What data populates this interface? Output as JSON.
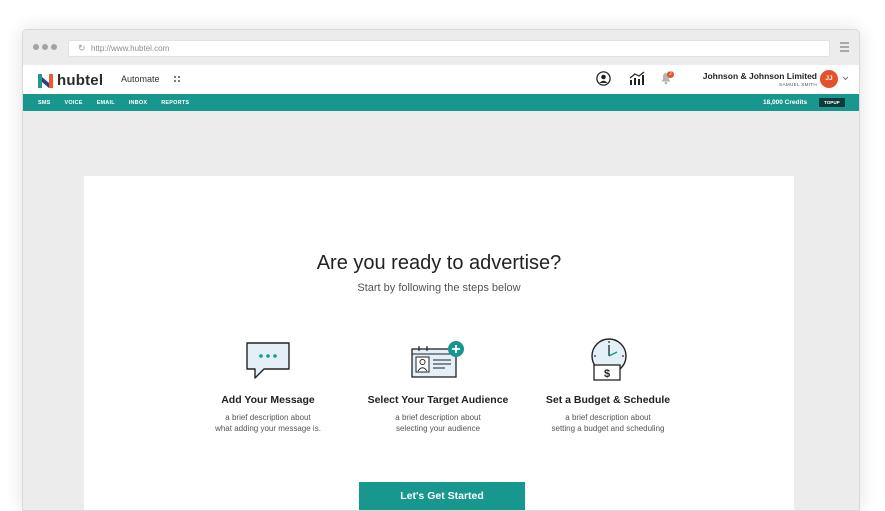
{
  "browser": {
    "url": "http://www.hubtel.com"
  },
  "app": {
    "logo_text": "hubtel",
    "section": "Automate",
    "account": {
      "company": "Johnson & Johnson Limited",
      "user": "SAMUEL SMITH",
      "initials": "JJ",
      "notification_count": "2"
    }
  },
  "nav": {
    "items": [
      "SMS",
      "VOICE",
      "EMAIL",
      "INBOX",
      "REPORTS"
    ],
    "credits": "18,000 Credits",
    "topup_label": "TOPUP"
  },
  "main": {
    "title": "Are you ready to advertise?",
    "subtitle": "Start by following the steps below",
    "steps": [
      {
        "icon": "chat-bubble-icon",
        "title": "Add Your Message",
        "desc_line1": "a brief description about",
        "desc_line2": "what adding your message is."
      },
      {
        "icon": "audience-card-icon",
        "title": "Select Your Target Audience",
        "desc_line1": "a brief description about",
        "desc_line2": "selecting your audience"
      },
      {
        "icon": "clock-dollar-icon",
        "title": "Set a Budget & Schedule",
        "desc_line1": "a brief description about",
        "desc_line2": "setting a budget and scheduling"
      }
    ],
    "cta_label": "Let's Get Started"
  },
  "colors": {
    "brand_teal": "#17978d",
    "accent_orange": "#e4512b",
    "topup_dark": "#0b3c3a"
  }
}
